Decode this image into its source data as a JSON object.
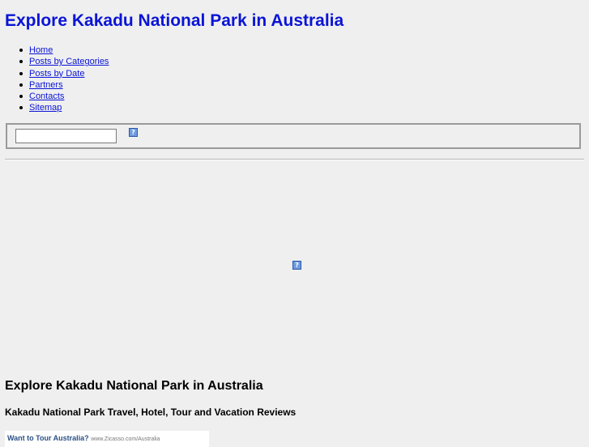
{
  "header": {
    "title": "Explore Kakadu National Park in Australia"
  },
  "nav": {
    "items": [
      {
        "label": "Home"
      },
      {
        "label": "Posts by Categories"
      },
      {
        "label": "Posts by Date"
      },
      {
        "label": "Partners"
      },
      {
        "label": "Contacts"
      },
      {
        "label": "Sitemap"
      }
    ]
  },
  "search": {
    "value": "",
    "button_icon": "broken-image-icon"
  },
  "banner": {
    "icon": "broken-image-icon"
  },
  "main": {
    "heading": "Explore Kakadu National Park in Australia",
    "subheading": "Kakadu National Park Travel, Hotel, Tour and Vacation Reviews"
  },
  "ad": {
    "title": "Want to Tour Australia?",
    "url": "www.Zicasso.com/Australia"
  },
  "colors": {
    "background": "#efefef",
    "link": "#0a14d6",
    "ad_title": "#2a4f86"
  }
}
